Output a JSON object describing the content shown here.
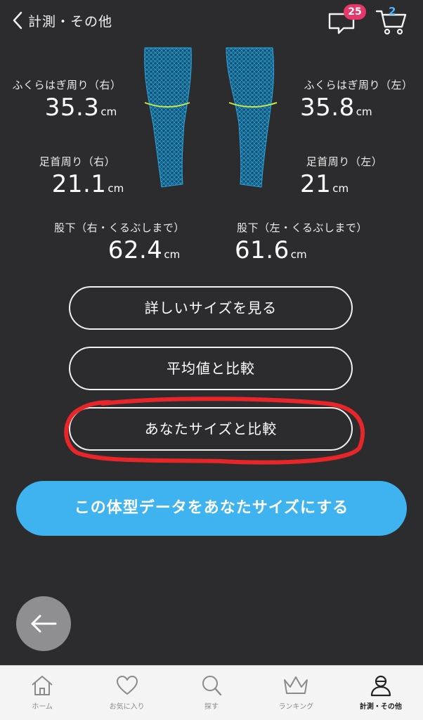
{
  "header": {
    "title": "計測・その他",
    "message_badge": "25",
    "cart_count": "2",
    "icons": {
      "back": "chevron-left-icon",
      "message": "chat-bubble-icon",
      "cart": "cart-icon"
    }
  },
  "measurements": {
    "calf_right": {
      "label": "ふくらはぎ周り（右）",
      "value": "35.3",
      "unit": "cm"
    },
    "calf_left": {
      "label": "ふくらはぎ周り（左）",
      "value": "35.8",
      "unit": "cm"
    },
    "ankle_right": {
      "label": "足首周り（右）",
      "value": "21.1",
      "unit": "cm"
    },
    "ankle_left": {
      "label": "足首周り（左）",
      "value": "21",
      "unit": "cm"
    },
    "inseam_right": {
      "label": "股下（右・くるぶしまで）",
      "value": "62.4",
      "unit": "cm"
    },
    "inseam_left": {
      "label": "股下（左・くるぶしまで）",
      "value": "61.6",
      "unit": "cm"
    }
  },
  "actions": {
    "detail_label": "詳しいサイズを見る",
    "compare_average_label": "平均値と比較",
    "compare_yours_label": "あなたサイズと比較",
    "set_as_yours_label": "この体型データをあなたサイズにする"
  },
  "colors": {
    "background": "#2c2c2e",
    "primary": "#3fb3f0",
    "badge": "#e6366a",
    "highlight": "#e8262a",
    "mesh": "#1f8fc9",
    "mesh_line": "#c8e84a"
  },
  "tabbar": {
    "items": [
      {
        "label": "ホーム",
        "icon": "home-icon"
      },
      {
        "label": "お気に入り",
        "icon": "heart-icon"
      },
      {
        "label": "探す",
        "icon": "search-icon"
      },
      {
        "label": "ランキング",
        "icon": "crown-icon"
      },
      {
        "label": "計測・その他",
        "icon": "person-icon",
        "active": true
      }
    ]
  }
}
